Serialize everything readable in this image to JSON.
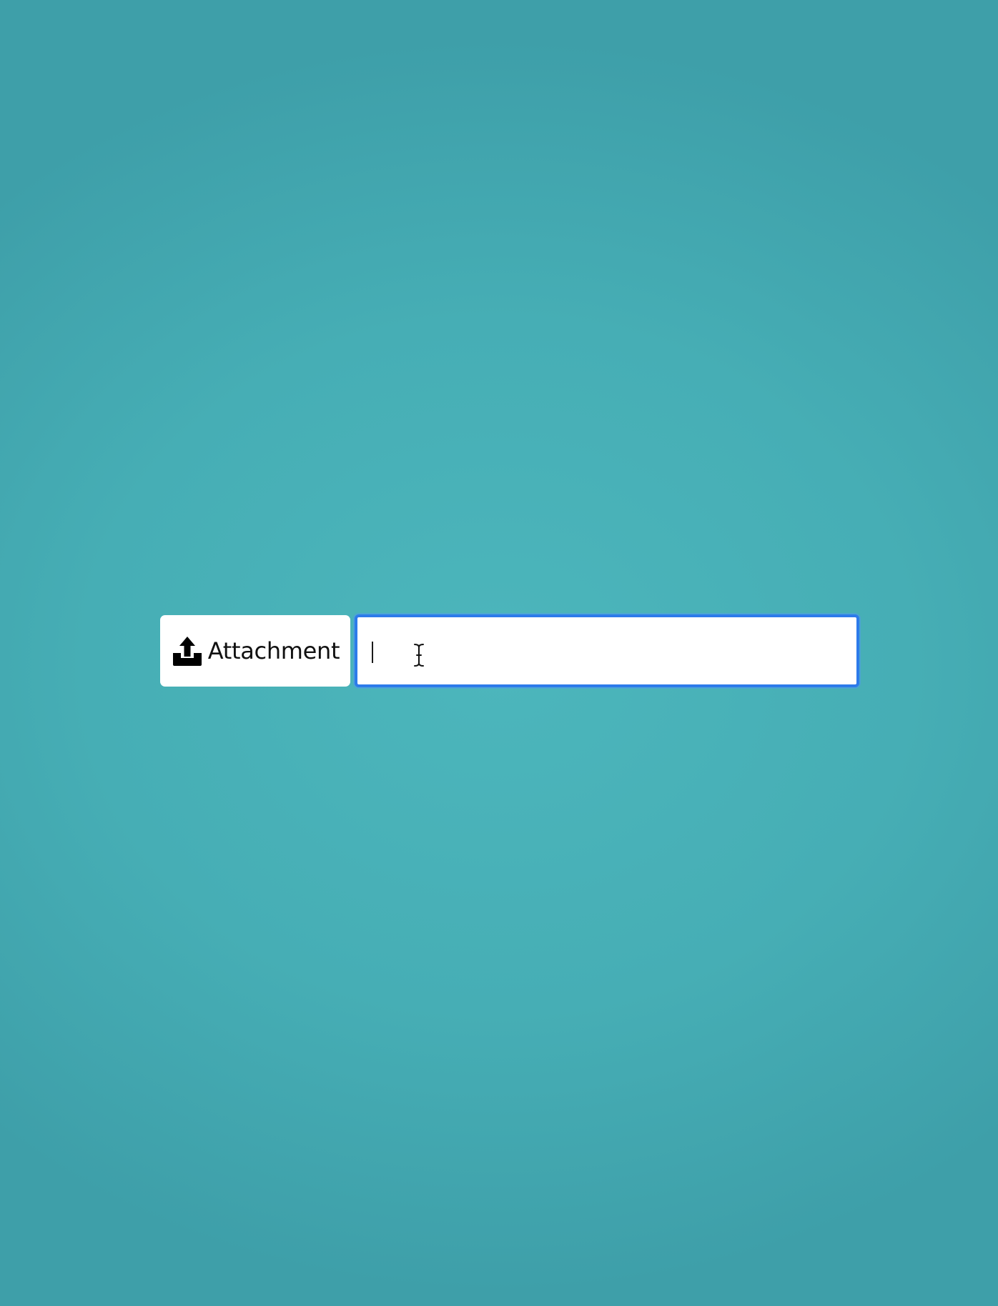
{
  "toolbar": {
    "attachment_label": "Attachment",
    "attachment_icon": "upload-tray-icon"
  },
  "text_field": {
    "value": "",
    "placeholder": "",
    "focused": true,
    "focus_color": "#2d7bea"
  },
  "colors": {
    "background": "#46aeb5",
    "button_background": "#ffffff"
  },
  "cursor": "text-ibeam-cursor"
}
